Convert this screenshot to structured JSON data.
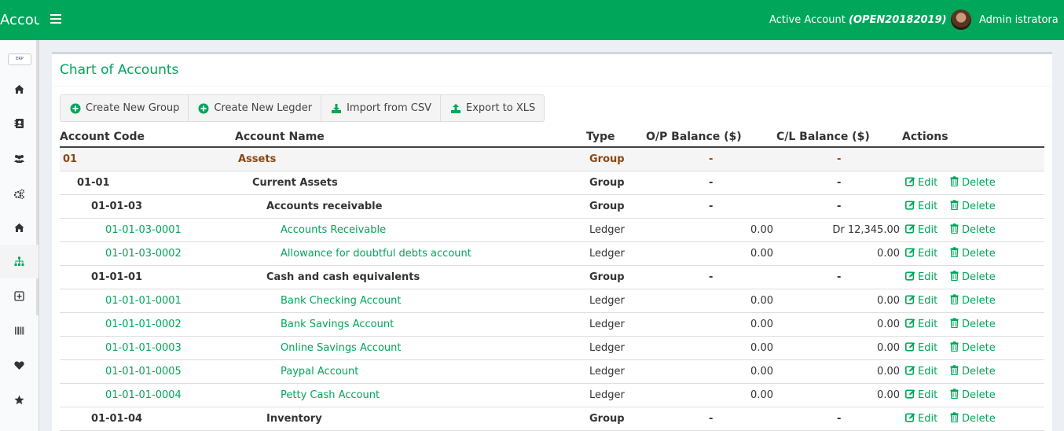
{
  "app": {
    "brand": "Accou",
    "active_account_label": "Active Account",
    "active_account_code": "(OPEN20182019)",
    "user_name": "Admin istratora"
  },
  "sidebar": {
    "logo_text": "ERP",
    "items": [
      {
        "icon": "home-icon"
      },
      {
        "icon": "address-book-icon"
      },
      {
        "icon": "users-icon"
      },
      {
        "icon": "cogs-icon"
      },
      {
        "icon": "home-icon"
      },
      {
        "icon": "sitemap-icon"
      },
      {
        "icon": "plus-square-icon"
      },
      {
        "icon": "barcode-icon"
      },
      {
        "icon": "heart-icon"
      },
      {
        "icon": "star-icon"
      }
    ]
  },
  "page": {
    "title": "Chart of Accounts",
    "toolbar": {
      "create_group": "Create New Group",
      "create_ledger": "Create New Legder",
      "import_csv": "Import from CSV",
      "export_xls": "Export to XLS"
    }
  },
  "table": {
    "headers": {
      "code": "Account Code",
      "name": "Account Name",
      "type": "Type",
      "ob": "O/P Balance ($)",
      "cb": "C/L Balance ($)",
      "actions": "Actions"
    },
    "edit_label": "Edit",
    "delete_label": "Delete",
    "rows": [
      {
        "level": 0,
        "kind": "root",
        "code": "01",
        "name": "Assets",
        "type": "Group",
        "ob": "-",
        "cb": "-",
        "actions": false
      },
      {
        "level": 1,
        "kind": "group",
        "code": "01-01",
        "name": "Current Assets",
        "type": "Group",
        "ob": "-",
        "cb": "-",
        "actions": true
      },
      {
        "level": 2,
        "kind": "group",
        "code": "01-01-03",
        "name": "Accounts receivable",
        "type": "Group",
        "ob": "-",
        "cb": "-",
        "actions": true
      },
      {
        "level": 3,
        "kind": "ledger",
        "code": "01-01-03-0001",
        "name": "Accounts Receivable",
        "type": "Ledger",
        "ob": "0.00",
        "cb": "Dr 12,345.00",
        "actions": true
      },
      {
        "level": 3,
        "kind": "ledger",
        "code": "01-01-03-0002",
        "name": "Allowance for doubtful debts account",
        "type": "Ledger",
        "ob": "0.00",
        "cb": "0.00",
        "actions": true
      },
      {
        "level": 2,
        "kind": "group",
        "code": "01-01-01",
        "name": "Cash and cash equivalents",
        "type": "Group",
        "ob": "-",
        "cb": "-",
        "actions": true
      },
      {
        "level": 3,
        "kind": "ledger",
        "code": "01-01-01-0001",
        "name": "Bank Checking Account",
        "type": "Ledger",
        "ob": "0.00",
        "cb": "0.00",
        "actions": true
      },
      {
        "level": 3,
        "kind": "ledger",
        "code": "01-01-01-0002",
        "name": "Bank Savings Account",
        "type": "Ledger",
        "ob": "0.00",
        "cb": "0.00",
        "actions": true
      },
      {
        "level": 3,
        "kind": "ledger",
        "code": "01-01-01-0003",
        "name": "Online Savings Account",
        "type": "Ledger",
        "ob": "0.00",
        "cb": "0.00",
        "actions": true
      },
      {
        "level": 3,
        "kind": "ledger",
        "code": "01-01-01-0005",
        "name": "Paypal Account",
        "type": "Ledger",
        "ob": "0.00",
        "cb": "0.00",
        "actions": true
      },
      {
        "level": 3,
        "kind": "ledger",
        "code": "01-01-01-0004",
        "name": "Petty Cash Account",
        "type": "Ledger",
        "ob": "0.00",
        "cb": "0.00",
        "actions": true
      },
      {
        "level": 2,
        "kind": "group",
        "code": "01-01-04",
        "name": "Inventory",
        "type": "Group",
        "ob": "-",
        "cb": "-",
        "actions": true
      }
    ]
  },
  "colors": {
    "brand": "#00a65a",
    "root_text": "#8b4513"
  }
}
